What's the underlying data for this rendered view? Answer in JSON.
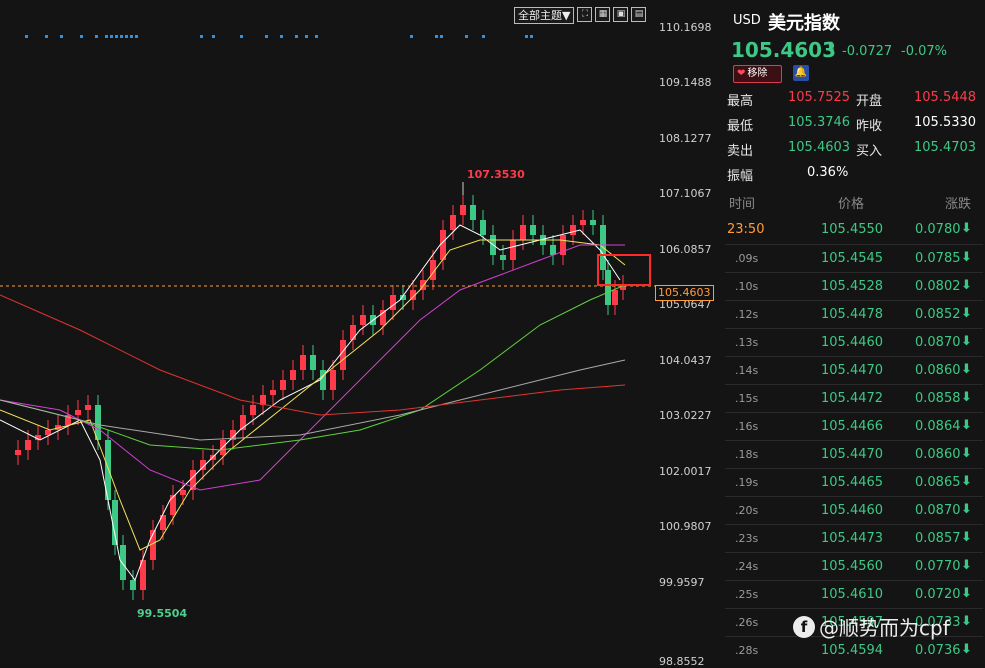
{
  "toolbar": {
    "theme_label": "全部主题▼",
    "icons": [
      "fullscreen-icon",
      "grid-icon",
      "layout-icon",
      "settings-icon"
    ]
  },
  "chart": {
    "y_ticks": [
      "110.1698",
      "109.1488",
      "108.1277",
      "107.1067",
      "106.0857",
      "105.0647",
      "104.0437",
      "103.0227",
      "102.0017",
      "100.9807",
      "99.9597",
      "98.8552"
    ],
    "high_label": "107.3530",
    "low_label": "99.5504",
    "last_price_tag": "105.4603",
    "colors": {
      "up": "#ff3a4a",
      "down": "#3dc985",
      "ma5": "#ffffff",
      "ma10": "#f2e35a",
      "ma20": "#d23fd6",
      "ma60": "#5fd13c",
      "ma120": "#aaaaaa",
      "ma250": "#e0352f",
      "last_line": "#ff9c3a"
    }
  },
  "header": {
    "code": "USD",
    "name": "美元指数",
    "price": "105.4603",
    "arrow": "⬇",
    "change": "-0.0727",
    "change_pct": "-0.07%",
    "remove_label": "移除"
  },
  "stats": {
    "high_label": "最高",
    "high_value": "105.7525",
    "open_label": "开盘",
    "open_value": "105.5448",
    "low_label": "最低",
    "low_value": "105.3746",
    "prev_label": "昨收",
    "prev_value": "105.5330",
    "sell_label": "卖出",
    "sell_value": "105.4603",
    "buy_label": "买入",
    "buy_value": "105.4703",
    "amp_label": "振幅",
    "amp_value": "0.36%"
  },
  "ticks_header": {
    "time": "时间",
    "price": "价格",
    "change": "涨跌"
  },
  "ticks": [
    {
      "time": "23:50",
      "price": "105.4550",
      "change": "0.0780"
    },
    {
      "time": ".09s",
      "price": "105.4545",
      "change": "0.0785"
    },
    {
      "time": ".10s",
      "price": "105.4528",
      "change": "0.0802"
    },
    {
      "time": ".12s",
      "price": "105.4478",
      "change": "0.0852"
    },
    {
      "time": ".13s",
      "price": "105.4460",
      "change": "0.0870"
    },
    {
      "time": ".14s",
      "price": "105.4470",
      "change": "0.0860"
    },
    {
      "time": ".15s",
      "price": "105.4472",
      "change": "0.0858"
    },
    {
      "time": ".16s",
      "price": "105.4466",
      "change": "0.0864"
    },
    {
      "time": ".18s",
      "price": "105.4470",
      "change": "0.0860"
    },
    {
      "time": ".19s",
      "price": "105.4465",
      "change": "0.0865"
    },
    {
      "time": ".20s",
      "price": "105.4460",
      "change": "0.0870"
    },
    {
      "time": ".23s",
      "price": "105.4473",
      "change": "0.0857"
    },
    {
      "time": ".24s",
      "price": "105.4560",
      "change": "0.0770"
    },
    {
      "time": ".25s",
      "price": "105.4610",
      "change": "0.0720"
    },
    {
      "time": ".26s",
      "price": "105.4597",
      "change": "0.0733"
    },
    {
      "time": ".28s",
      "price": "105.4594",
      "change": "0.0736"
    }
  ],
  "watermark": {
    "icon": "facebook-icon",
    "text": "@顺势而为cpf"
  }
}
